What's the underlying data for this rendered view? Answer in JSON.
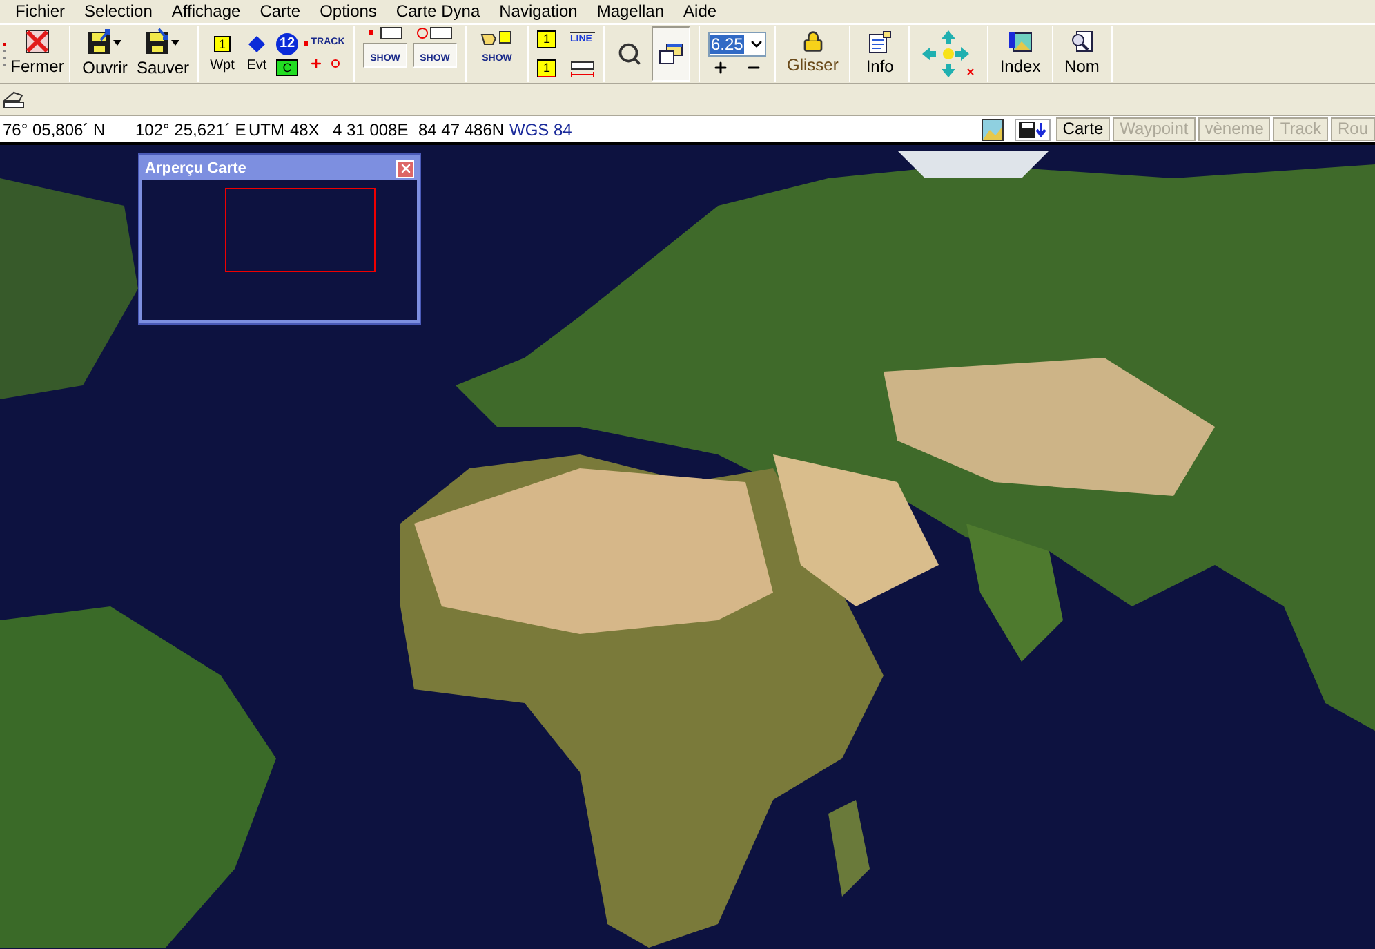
{
  "menu": [
    "Fichier",
    "Selection",
    "Affichage",
    "Carte",
    "Options",
    "Carte Dyna",
    "Navigation",
    "Magellan",
    "Aide"
  ],
  "toolbar": {
    "file_buttons": [
      {
        "label": "Fermer"
      },
      {
        "label": "Ouvrir"
      },
      {
        "label": "Sauver"
      }
    ],
    "waypoint_tools": {
      "wpt_icon_text": "1",
      "wpt": "Wpt",
      "evt": "Evt",
      "route_number": "12",
      "track": "TRACK",
      "c": "C"
    },
    "show_buttons": [
      {
        "label": "SHOW",
        "pressed": true
      },
      {
        "label": "SHOW",
        "pressed": true
      },
      {
        "label": "SHOW",
        "pressed": false
      }
    ],
    "page_tools": {
      "page_number": "1",
      "line": "LINE",
      "measure_number": "1"
    },
    "overview_pressed": true,
    "zoom": {
      "value": "6.25"
    },
    "labeled_buttons": [
      {
        "label": "Glisser"
      },
      {
        "label": "Info"
      },
      {
        "label": "Index"
      },
      {
        "label": "Nom"
      }
    ]
  },
  "status_bar": {
    "latitude": "76° 05,806´ N",
    "longitude": "102° 25,621´ E",
    "grid": "UTM",
    "zone": "48X",
    "easting": "4 31 008E",
    "northing": "84 47 486N",
    "datum": "WGS 84",
    "tabs": [
      {
        "label": "Carte",
        "disabled": false
      },
      {
        "label": "Waypoint",
        "disabled": true
      },
      {
        "label": "vèneme",
        "disabled": true
      },
      {
        "label": "Track",
        "disabled": true
      },
      {
        "label": "Rou",
        "disabled": true
      }
    ]
  },
  "overview_window": {
    "title": "Arperçu Carte"
  }
}
